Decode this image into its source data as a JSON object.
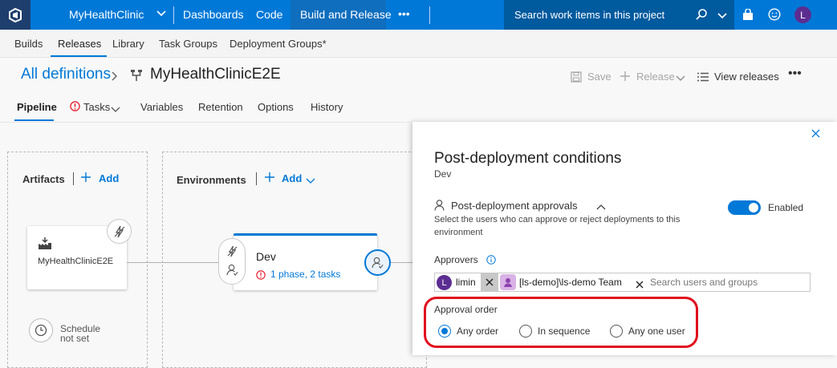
{
  "topbar": {
    "project": "MyHealthClinic",
    "nav": [
      "Dashboards",
      "Code",
      "Build and Release"
    ],
    "more": "•••",
    "search_placeholder": "Search work items in this project",
    "avatar_initial": "L"
  },
  "subnav": {
    "items": [
      "Builds",
      "Releases",
      "Library",
      "Task Groups",
      "Deployment Groups*"
    ],
    "active": "Releases"
  },
  "header": {
    "breadcrumb": "All definitions",
    "definition_name": "MyHealthClinicE2E",
    "save": "Save",
    "release": "Release",
    "view_releases": "View releases",
    "more": "•••"
  },
  "tabs": [
    "Pipeline",
    "Tasks",
    "Variables",
    "Retention",
    "Options",
    "History"
  ],
  "pipeline": {
    "artifacts_label": "Artifacts",
    "artifacts_add": "Add",
    "artifact_name": "MyHealthClinicE2E",
    "schedule_line1": "Schedule",
    "schedule_line2": "not set",
    "environments_label": "Environments",
    "environments_add": "Add",
    "env_name": "Dev",
    "env_info": "1 phase, 2 tasks"
  },
  "panel": {
    "title": "Post-deployment conditions",
    "subtitle": "Dev",
    "approvals_label": "Post-deployment approvals",
    "approvals_desc_1": "Select the users who can approve or reject deployments to this",
    "approvals_desc_2": "environment",
    "toggle_label": "Enabled",
    "approvers_label": "Approvers",
    "approver_1_initial": "L",
    "approver_1": "limin",
    "approver_2": "[ls-demo]\\ls-demo Team",
    "search_placeholder": "Search users and groups",
    "approval_order_label": "Approval order",
    "options": [
      "Any order",
      "In sequence",
      "Any one user"
    ],
    "selected_option": "Any order"
  },
  "colors": {
    "accent": "#0078d7",
    "topbar": "#0078d7",
    "highlight": "#e0101e",
    "avatar": "#5c2d91",
    "warning": "#e81123"
  }
}
